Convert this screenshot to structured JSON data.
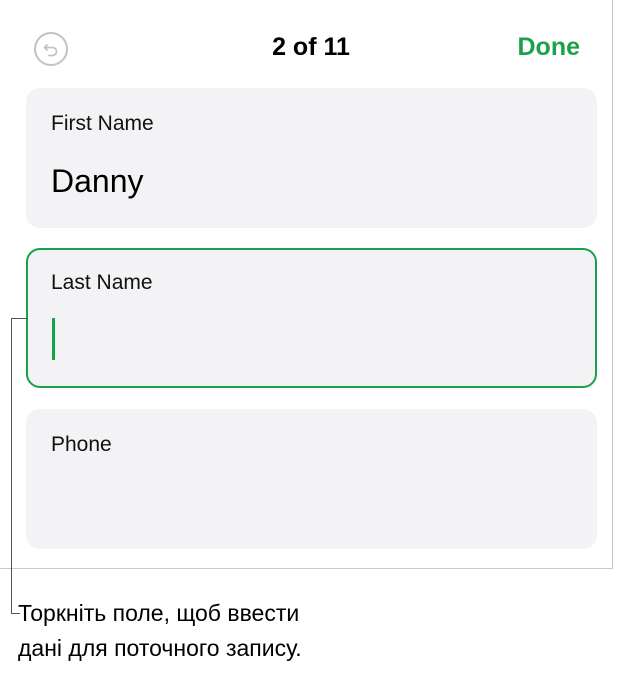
{
  "header": {
    "title": "2 of 11",
    "done_label": "Done",
    "undo_icon": "undo-icon"
  },
  "fields": [
    {
      "label": "First Name",
      "value": "Danny",
      "active": false
    },
    {
      "label": "Last Name",
      "value": "",
      "active": true
    },
    {
      "label": "Phone",
      "value": "",
      "active": false
    }
  ],
  "callout": {
    "line1": "Торкніть поле, щоб ввести",
    "line2": "дані для поточного запису."
  },
  "colors": {
    "accent": "#1aa24a",
    "field_bg": "#f3f3f5",
    "icon_gray": "#c2c2c6"
  }
}
